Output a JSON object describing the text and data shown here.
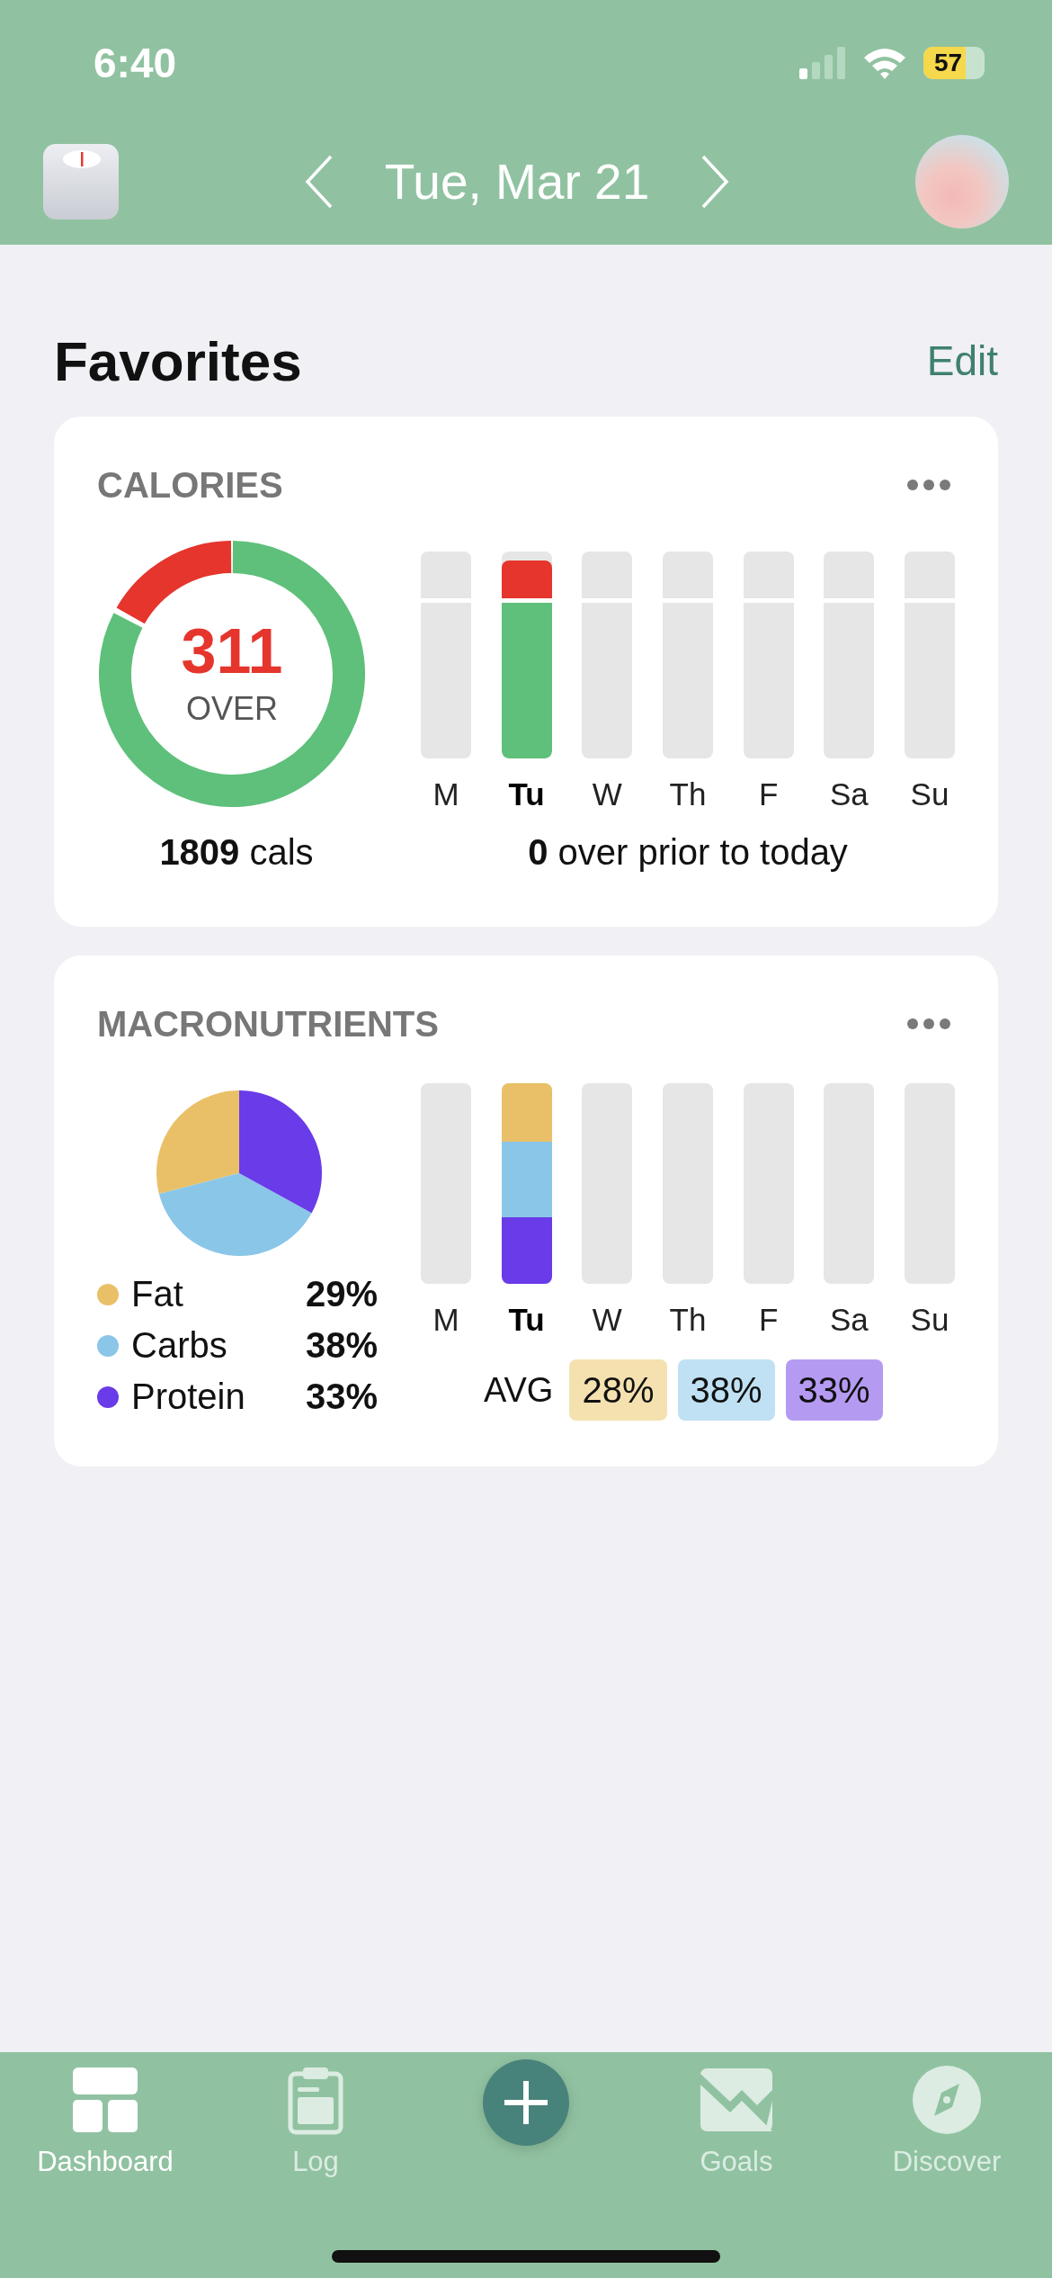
{
  "status_bar": {
    "time": "6:40",
    "battery": "57"
  },
  "header": {
    "date": "Tue, Mar 21"
  },
  "section": {
    "title": "Favorites",
    "action": "Edit"
  },
  "calories": {
    "title": "CALORIES",
    "ring": {
      "level": 0.17
    },
    "value": "311",
    "value_label": "OVER",
    "total": "**1809** cals",
    "weekly": "**0** over prior to today",
    "days": [
      {
        "label": "M",
        "selected": false
      },
      {
        "label": "Tu",
        "selected": true,
        "level": 0.957
      },
      {
        "label": "W",
        "selected": false
      },
      {
        "label": "Th",
        "selected": false
      },
      {
        "label": "F",
        "selected": false
      },
      {
        "label": "Sa",
        "selected": false
      },
      {
        "label": "Su",
        "selected": false
      }
    ]
  },
  "macros": {
    "title": "MACRONUTRIENTS",
    "chart_data": {
      "type": "pie",
      "categories": [
        "Fat",
        "Carbs",
        "Protein"
      ],
      "values": [
        29,
        38,
        33
      ]
    },
    "legend": [
      {
        "value": "29%",
        "color": "#e9c067"
      },
      {
        "value": "38%",
        "color": "#8ac6e8"
      },
      {
        "value": "33%",
        "color": "#6a3be8"
      }
    ],
    "days": [
      {
        "label": "M",
        "selected": false
      },
      {
        "label": "Tu",
        "selected": true,
        "segments": [
          {
            "color": "#e9c067"
          },
          {
            "color": "#8ac6e8"
          },
          {
            "color": "#6a3be8"
          }
        ]
      },
      {
        "label": "W",
        "selected": false
      },
      {
        "label": "Th",
        "selected": false
      },
      {
        "label": "F",
        "selected": false
      },
      {
        "label": "Sa",
        "selected": false
      },
      {
        "label": "Su",
        "selected": false
      }
    ],
    "avg": {
      "label": "AVG",
      "chips": [
        {
          "value": "28%",
          "color": "#f5e1b0"
        },
        {
          "value": "38%",
          "color": "#bfe1f3"
        },
        {
          "value": "33%",
          "color": "#b59af2"
        }
      ]
    }
  },
  "tabs": [
    {
      "label": "Dashboard",
      "kind": "dashboard",
      "selected": true
    },
    {
      "label": "Log",
      "kind": "log",
      "selected": false
    },
    {
      "kind": "add",
      "selected": false
    },
    {
      "label": "Goals",
      "kind": "goals",
      "selected": false
    },
    {
      "label": "Discover",
      "kind": "discover",
      "selected": false
    }
  ]
}
